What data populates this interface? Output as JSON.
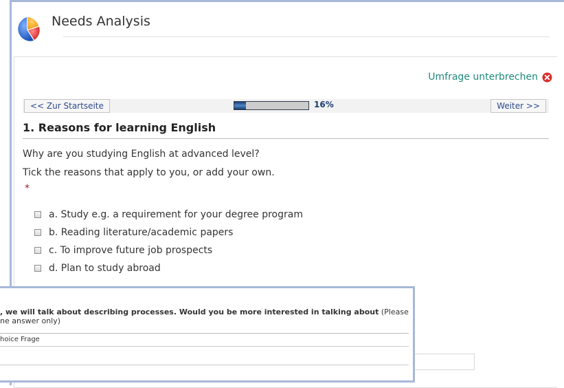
{
  "app": {
    "title": "Needs Analysis"
  },
  "actions": {
    "interrupt_label": "Umfrage unterbrechen"
  },
  "nav": {
    "home_label": "<< Zur Startseite",
    "next_label": "Weiter >>",
    "progress_value": 16,
    "progress_text": "16%"
  },
  "question": {
    "title": "1. Reasons for learning English",
    "line1": "Why are you studying English at advanced level?",
    "line2": "Tick the reasons that apply to you, or add your own.",
    "required_mark": "*",
    "options": [
      {
        "label": "a. Study e.g. a requirement for your degree program"
      },
      {
        "label": "b. Reading literature/academic papers"
      },
      {
        "label": "c. To improve future job prospects"
      },
      {
        "label": "d. Plan to study abroad"
      }
    ]
  },
  "inset": {
    "text_bold": ", we will talk about describing processes. Would you be more interested in talking about",
    "text_normal": " (Please",
    "text_line2": "ne answer only)",
    "type_label": "hoice Frage"
  },
  "colors": {
    "frame": "#a7b8d8",
    "link": "#1e8a7c",
    "progress": "#1a3b6e",
    "required": "#9b1c1c"
  }
}
